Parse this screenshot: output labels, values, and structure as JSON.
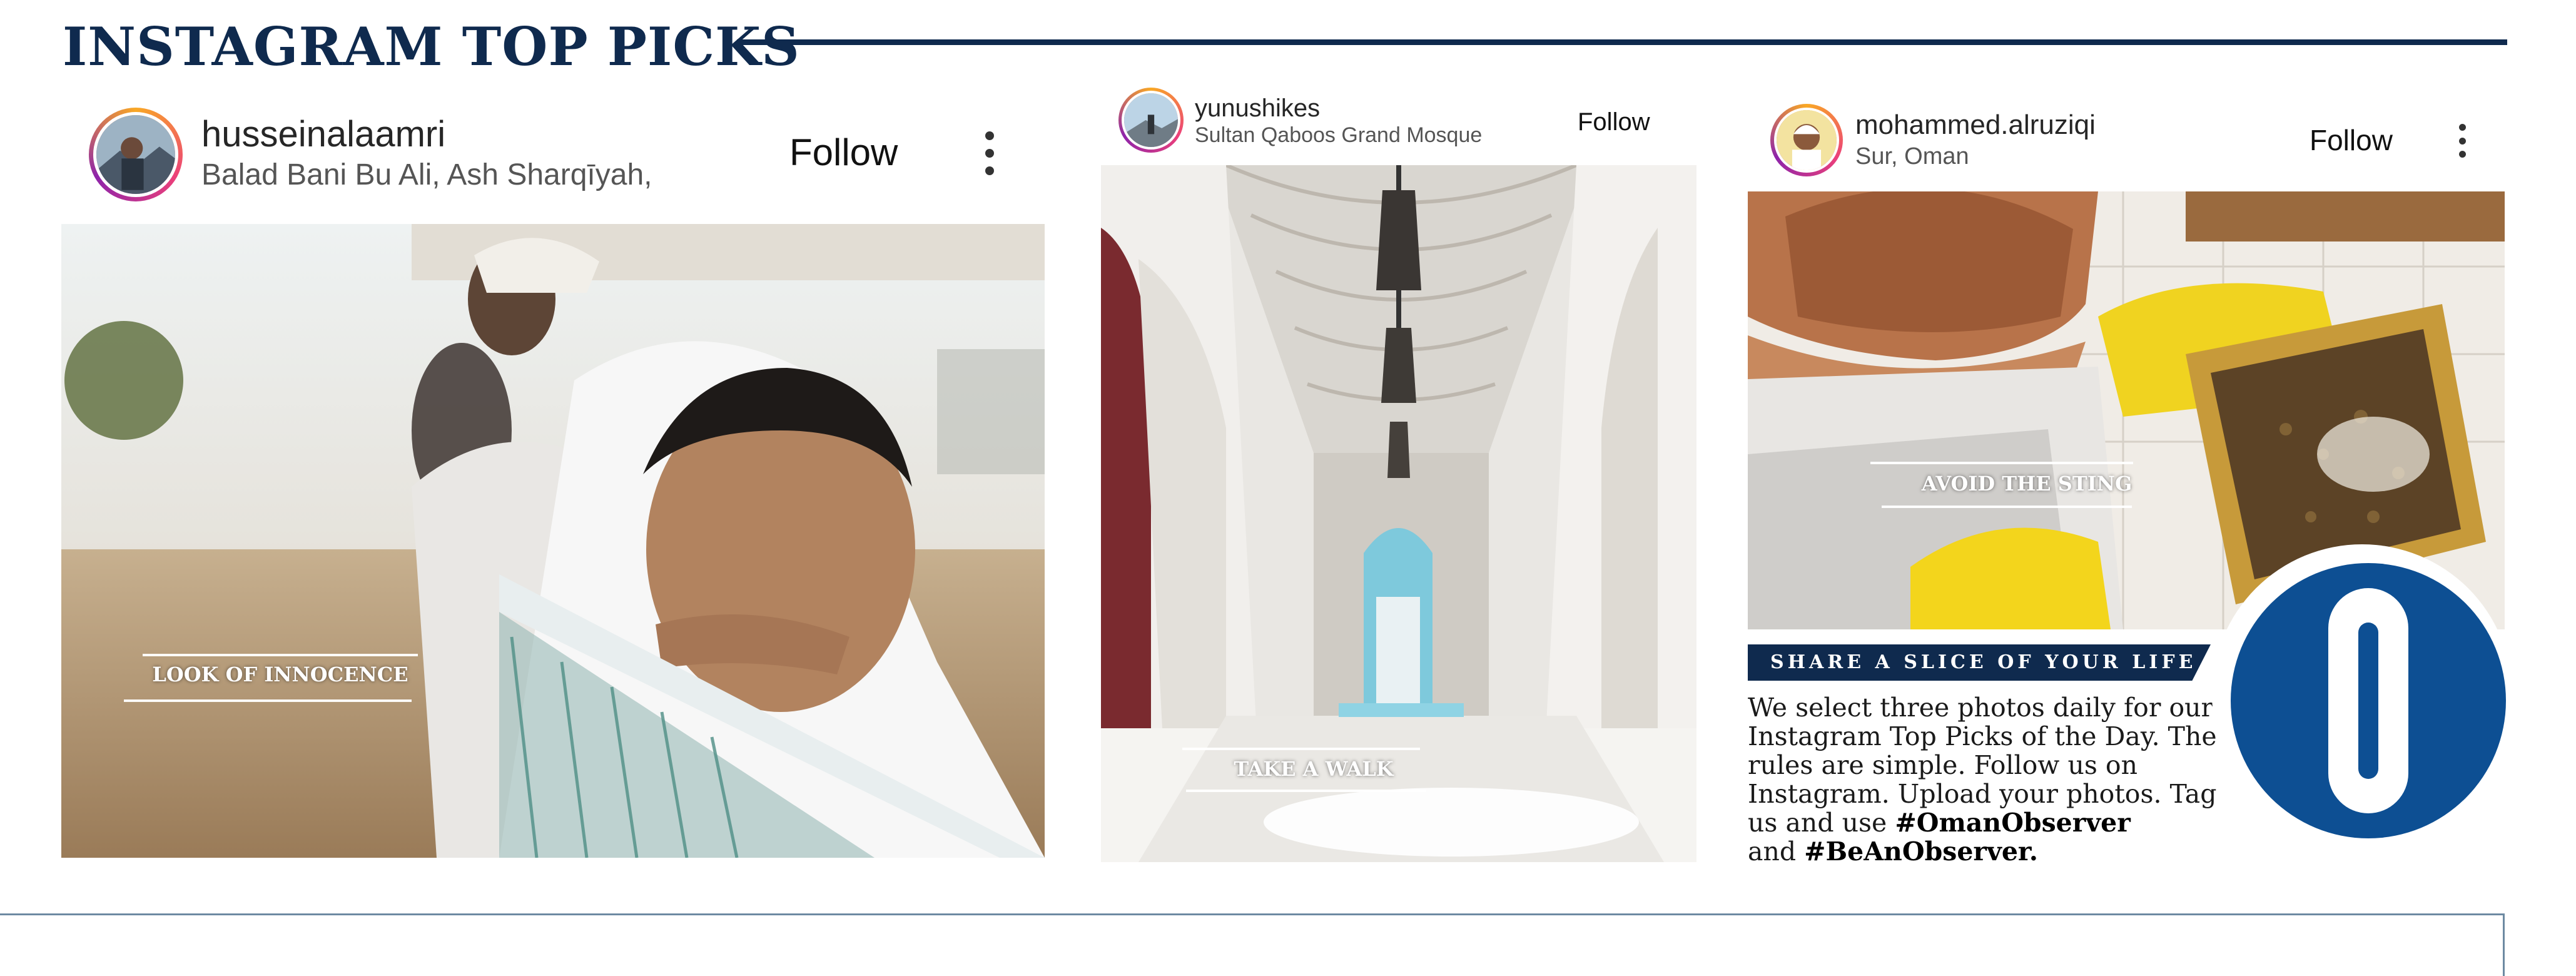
{
  "header": {
    "title": "INSTAGRAM TOP PICKS"
  },
  "posts": [
    {
      "username": "husseinalaamri",
      "location": "Balad Bani Bu Ali, Ash Sharqīyah,",
      "follow_label": "Follow",
      "caption": "LOOK OF INNOCENCE"
    },
    {
      "username": "yunushikes",
      "location": "Sultan Qaboos Grand Mosque",
      "follow_label": "Follow",
      "caption": "TAKE A WALK"
    },
    {
      "username": "mohammed.alruziqi",
      "location": "Sur, Oman",
      "follow_label": "Follow",
      "caption": "AVOID THE STING"
    }
  ],
  "share": {
    "banner": "SHARE A SLICE OF YOUR LIFE",
    "body": "We select three photos daily for our Instagram Top Picks of the Day. The rules are simple. Follow us on Instagram. Upload your photos. Tag us and use",
    "hashtag1": "#OmanObserver",
    "and": "and",
    "hashtag2": "#BeAnObserver."
  },
  "colors": {
    "navy": "#0f2a4e",
    "logo_blue": "#0d4f93"
  },
  "icons": [
    "more-options-icon",
    "observer-o-logo"
  ]
}
